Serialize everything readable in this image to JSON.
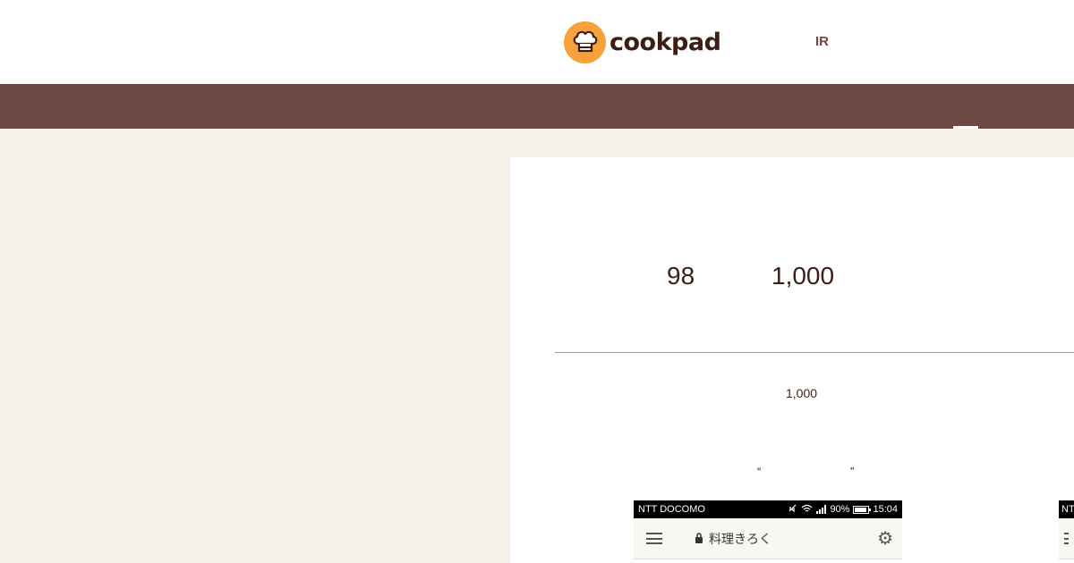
{
  "header": {
    "logo_text": "cookpad",
    "ir_label": "IR",
    "brand_color": "#f7a13b",
    "nav_color": "#6e4944"
  },
  "card": {
    "stat_a": "98",
    "stat_b": "1,000",
    "sub_stat": "1,000",
    "quote_open": "“",
    "quote_close": "”"
  },
  "phone": {
    "carrier": "NTT DOCOMO",
    "battery_text": "90%",
    "time": "15:04",
    "app_title": "料理きろく",
    "icons": [
      "menu-icon",
      "lock-icon",
      "gear-icon",
      "mute-icon",
      "wifi-icon",
      "signal-icon",
      "battery-icon"
    ]
  },
  "phone_2": {
    "carrier": "NT"
  }
}
